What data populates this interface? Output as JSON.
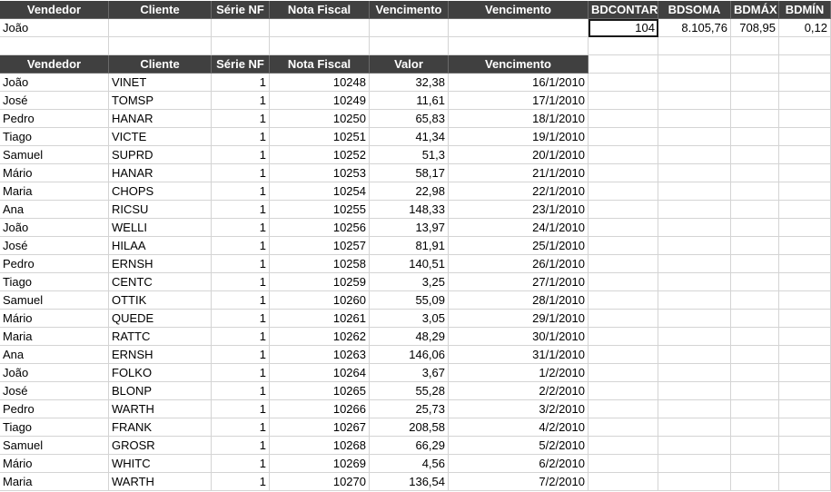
{
  "criteria": {
    "headers": [
      "Vendedor",
      "Cliente",
      "Série NF",
      "Nota Fiscal",
      "Vencimento",
      "Vencimento",
      "BDCONTAR",
      "BDSOMA",
      "BDMÁX",
      "BDMÍN"
    ],
    "values": [
      "João",
      "",
      "",
      "",
      "",
      "",
      "104",
      "8.105,76",
      "708,95",
      "0,12"
    ]
  },
  "table": {
    "headers": [
      "Vendedor",
      "Cliente",
      "Série NF",
      "Nota Fiscal",
      "Valor",
      "Vencimento"
    ],
    "rows": [
      [
        "João",
        "VINET",
        "1",
        "10248",
        "32,38",
        "16/1/2010"
      ],
      [
        "José",
        "TOMSP",
        "1",
        "10249",
        "11,61",
        "17/1/2010"
      ],
      [
        "Pedro",
        "HANAR",
        "1",
        "10250",
        "65,83",
        "18/1/2010"
      ],
      [
        "Tiago",
        "VICTE",
        "1",
        "10251",
        "41,34",
        "19/1/2010"
      ],
      [
        "Samuel",
        "SUPRD",
        "1",
        "10252",
        "51,3",
        "20/1/2010"
      ],
      [
        "Mário",
        "HANAR",
        "1",
        "10253",
        "58,17",
        "21/1/2010"
      ],
      [
        "Maria",
        "CHOPS",
        "1",
        "10254",
        "22,98",
        "22/1/2010"
      ],
      [
        "Ana",
        "RICSU",
        "1",
        "10255",
        "148,33",
        "23/1/2010"
      ],
      [
        "João",
        "WELLI",
        "1",
        "10256",
        "13,97",
        "24/1/2010"
      ],
      [
        "José",
        "HILAA",
        "1",
        "10257",
        "81,91",
        "25/1/2010"
      ],
      [
        "Pedro",
        "ERNSH",
        "1",
        "10258",
        "140,51",
        "26/1/2010"
      ],
      [
        "Tiago",
        "CENTC",
        "1",
        "10259",
        "3,25",
        "27/1/2010"
      ],
      [
        "Samuel",
        "OTTIK",
        "1",
        "10260",
        "55,09",
        "28/1/2010"
      ],
      [
        "Mário",
        "QUEDE",
        "1",
        "10261",
        "3,05",
        "29/1/2010"
      ],
      [
        "Maria",
        "RATTC",
        "1",
        "10262",
        "48,29",
        "30/1/2010"
      ],
      [
        "Ana",
        "ERNSH",
        "1",
        "10263",
        "146,06",
        "31/1/2010"
      ],
      [
        "João",
        "FOLKO",
        "1",
        "10264",
        "3,67",
        "1/2/2010"
      ],
      [
        "José",
        "BLONP",
        "1",
        "10265",
        "55,28",
        "2/2/2010"
      ],
      [
        "Pedro",
        "WARTH",
        "1",
        "10266",
        "25,73",
        "3/2/2010"
      ],
      [
        "Tiago",
        "FRANK",
        "1",
        "10267",
        "208,58",
        "4/2/2010"
      ],
      [
        "Samuel",
        "GROSR",
        "1",
        "10268",
        "66,29",
        "5/2/2010"
      ],
      [
        "Mário",
        "WHITC",
        "1",
        "10269",
        "4,56",
        "6/2/2010"
      ],
      [
        "Maria",
        "WARTH",
        "1",
        "10270",
        "136,54",
        "7/2/2010"
      ]
    ]
  }
}
